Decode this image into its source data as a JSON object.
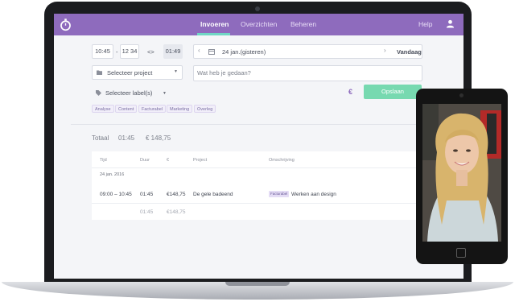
{
  "nav": {
    "tabs": [
      {
        "label": "Invoeren",
        "active": true
      },
      {
        "label": "Overzichten",
        "active": false
      },
      {
        "label": "Beheren",
        "active": false
      }
    ],
    "help": "Help",
    "logo_icon": "stopwatch-icon",
    "user_icon": "user-icon",
    "color": "#8e6bbd",
    "accent": "#6fd6c4"
  },
  "entry": {
    "start_time": "10:45",
    "dash": "-",
    "end_time": "12 34",
    "swap_icon": "<>",
    "duration": "01:49",
    "date": "24 jan.(gisteren)",
    "today": "Vandaag",
    "project_placeholder": "Selecteer project",
    "description_placeholder": "Wat heb je gedaan?",
    "label_placeholder": "Selecteer label(s)",
    "currency_symbol": "€",
    "save_label": "Opslaan",
    "save_color": "#77d9b0",
    "tags": [
      "Analyse",
      "Content",
      "Facturabel",
      "Marketing",
      "Overleg"
    ]
  },
  "totals": {
    "label": "Totaal",
    "duration": "01:45",
    "amount": "€ 148,75"
  },
  "table": {
    "headers": [
      "Tijd",
      "Duur",
      "€",
      "Project",
      "Omschrijving"
    ],
    "date_group": "24 jan. 2016",
    "row": {
      "time": "09:00 – 10:45",
      "duration": "01:45",
      "amount": "€148,75",
      "project": "De gele badeend",
      "badge": "Facturabel",
      "description": "Werken aan design"
    },
    "subtotal": {
      "duration": "01:45",
      "amount": "€148,75"
    }
  }
}
